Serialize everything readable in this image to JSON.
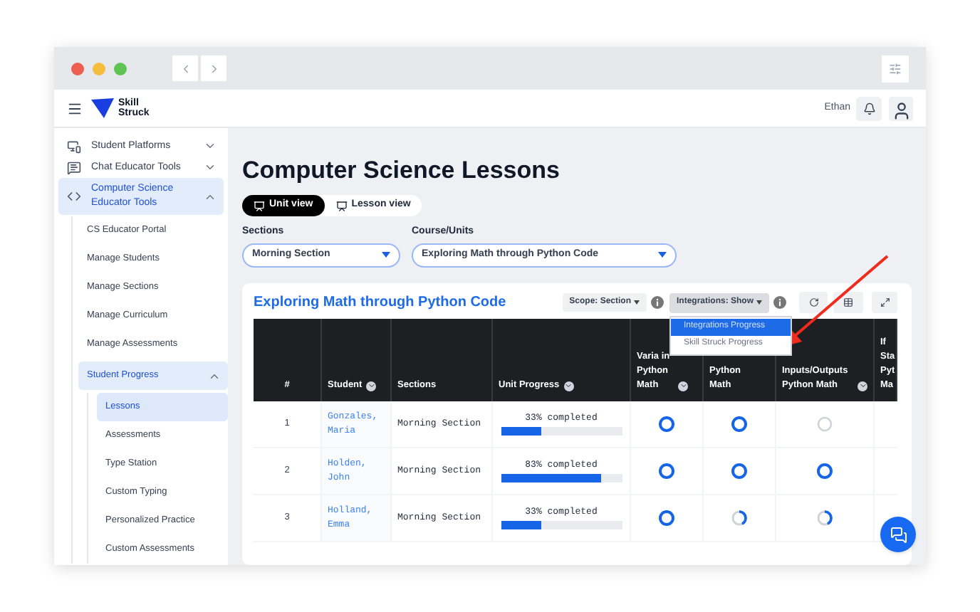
{
  "header": {
    "logo_text": "Skill Struck",
    "user_name": "Ethan"
  },
  "sidebar": {
    "items": [
      {
        "label": "Student Platforms",
        "expanded": false,
        "selected": false
      },
      {
        "label": "Chat Educator Tools",
        "expanded": false,
        "selected": false
      },
      {
        "label": "Computer Science Educator Tools",
        "expanded": true,
        "selected": true,
        "children": [
          {
            "label": "CS Educator Portal",
            "selected": false
          },
          {
            "label": "Manage Students",
            "selected": false
          },
          {
            "label": "Manage Sections",
            "selected": false
          },
          {
            "label": "Manage Curriculum",
            "selected": false
          },
          {
            "label": "Manage Assessments",
            "selected": false
          },
          {
            "label": "Student Progress",
            "expanded": true,
            "selected": true,
            "children": [
              {
                "label": "Lessons",
                "selected": true
              },
              {
                "label": "Assessments",
                "selected": false
              },
              {
                "label": "Type Station",
                "selected": false
              },
              {
                "label": "Custom Typing",
                "selected": false
              },
              {
                "label": "Personalized Practice",
                "selected": false
              },
              {
                "label": "Custom Assessments",
                "selected": false
              }
            ]
          }
        ]
      }
    ]
  },
  "page": {
    "title": "Computer Science Lessons",
    "view_toggle": [
      {
        "label": "Unit view",
        "selected": true
      },
      {
        "label": "Lesson view",
        "selected": false
      }
    ],
    "filters": [
      {
        "label": "Sections",
        "value": "Morning Section"
      },
      {
        "label": "Course/Units",
        "value": "Exploring Math through Python Code"
      }
    ]
  },
  "card": {
    "title": "Exploring Math through Python Code",
    "scope_button": "Scope: Section",
    "integrations_button": "Integrations: Show",
    "integrations_menu": {
      "open": true,
      "items": [
        {
          "label": "Integrations Progress",
          "selected": true
        },
        {
          "label": "Skill Struck Progress",
          "selected": false
        }
      ]
    }
  },
  "table": {
    "columns": [
      {
        "label": "#",
        "sortable": false
      },
      {
        "label": "Student",
        "sortable": true
      },
      {
        "label": "Sections",
        "sortable": false
      },
      {
        "label": "Unit Progress",
        "sortable": true
      },
      {
        "label": "Varia in Python Math",
        "sortable": true
      },
      {
        "label": "Python Math"
      },
      {
        "label": "Inputs/Outputs Python Math",
        "sortable": true
      },
      {
        "label": "If Sta Pyt Ma",
        "sortable": false
      }
    ],
    "rows": [
      {
        "number": "1",
        "student": "Gonzales, Maria",
        "section": "Morning Section",
        "progress_text": "33% completed",
        "level": 0.33,
        "statuses": [
          {
            "kind": "complete"
          },
          {
            "kind": "complete"
          },
          {
            "kind": "not_started"
          }
        ]
      },
      {
        "number": "2",
        "student": "Holden, John",
        "section": "Morning Section",
        "progress_text": "83% completed",
        "level": 0.83,
        "statuses": [
          {
            "kind": "complete"
          },
          {
            "kind": "complete"
          },
          {
            "kind": "complete"
          }
        ]
      },
      {
        "number": "3",
        "student": "Holland, Emma",
        "section": "Morning Section",
        "progress_text": "33% completed",
        "level": 0.33,
        "statuses": [
          {
            "kind": "complete"
          },
          {
            "kind": "partial"
          },
          {
            "kind": "partial"
          }
        ]
      }
    ]
  }
}
